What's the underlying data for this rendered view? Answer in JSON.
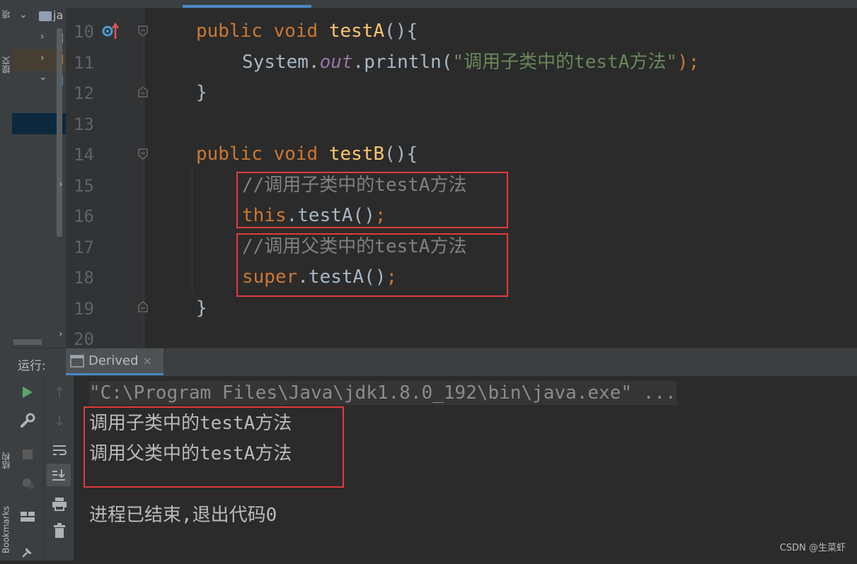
{
  "left_strip": {
    "top_label": "项",
    "commit_label": "提交",
    "structure_label": "结构",
    "bookmarks_label": "Bookmarks"
  },
  "project_panel": {
    "root_label": "ja"
  },
  "editor": {
    "line_numbers": [
      "10",
      "11",
      "12",
      "13",
      "14",
      "15",
      "16",
      "17",
      "18",
      "19",
      "20"
    ],
    "lines": {
      "l10": {
        "kw1": "public",
        "kw2": "void",
        "name": "testA",
        "rest": "(){"
      },
      "l11": {
        "obj": "System.",
        "field": "out",
        "call": ".println(",
        "str": "\"调用子类中的testA方法\"",
        "end": ");"
      },
      "l12": {
        "text": "}"
      },
      "l14": {
        "kw1": "public",
        "kw2": "void",
        "name": "testB",
        "rest": "(){"
      },
      "l15": {
        "comment": "//调用子类中的testA方法"
      },
      "l16": {
        "kw": "this",
        "call": ".testA()",
        "end": ";"
      },
      "l17": {
        "comment": "//调用父类中的testA方法"
      },
      "l18": {
        "kw": "super",
        "call": ".testA()",
        "end": ";"
      },
      "l19": {
        "text": "}"
      }
    }
  },
  "run_panel": {
    "label": "运行:",
    "tab_name": "Derived",
    "tab_close": "×"
  },
  "console": {
    "command": "\"C:\\Program Files\\Java\\jdk1.8.0_192\\bin\\java.exe\" ...",
    "output": [
      "调用子类中的testA方法",
      "调用父类中的testA方法"
    ],
    "exit_message": "进程已结束,退出代码0"
  },
  "watermark": "CSDN @生菜虾",
  "colors": {
    "keyword": "#cc7832",
    "method": "#ffc66d",
    "string": "#6a8759",
    "comment": "#808080",
    "highlight_box": "#e03a3a",
    "run_green": "#59a869"
  }
}
